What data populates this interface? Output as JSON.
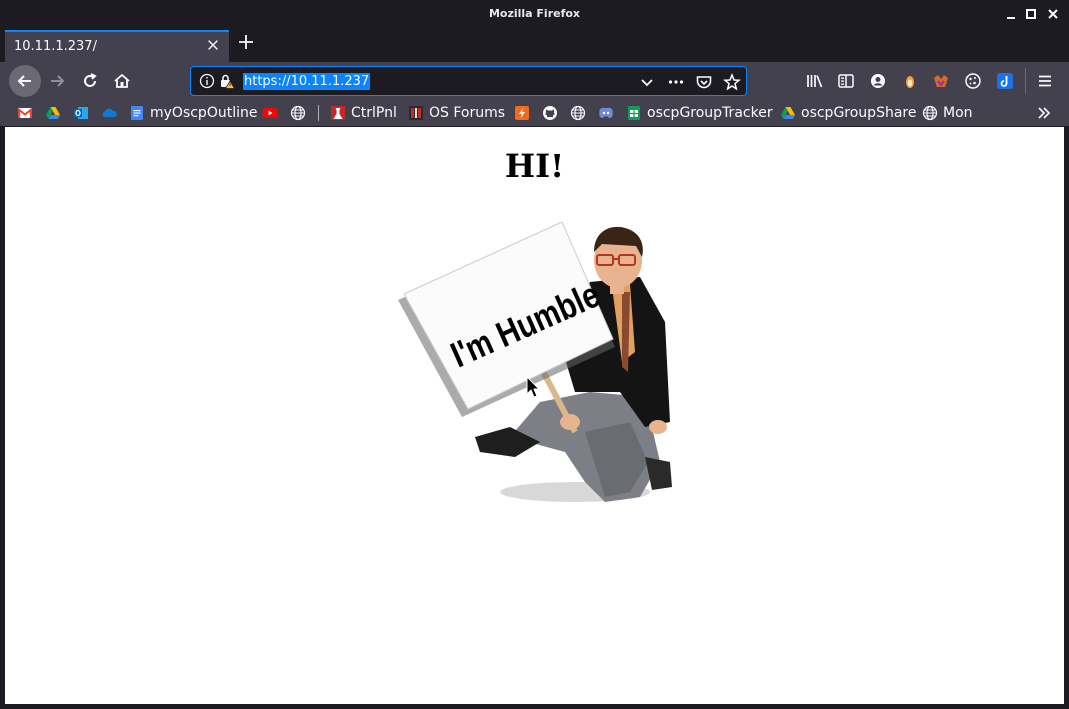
{
  "window": {
    "title": "Mozilla Firefox",
    "controls": [
      "minimize",
      "maximize",
      "close"
    ]
  },
  "tabs": [
    {
      "title": "10.11.1.237/",
      "active": true
    }
  ],
  "urlbar": {
    "url": "https://10.11.1.237"
  },
  "bookmarks": {
    "items": [
      {
        "label": "",
        "icon": "gmail-icon"
      },
      {
        "label": "",
        "icon": "google-drive-icon"
      },
      {
        "label": "",
        "icon": "outlook-icon"
      },
      {
        "label": "",
        "icon": "onedrive-icon"
      },
      {
        "label": "myOscpOutline",
        "icon": "google-docs-icon"
      },
      {
        "label": "",
        "icon": "youtube-icon"
      },
      {
        "label": "",
        "icon": "globe-icon"
      },
      {
        "label": "CtrlPnl",
        "icon": "ctrlpnl-icon"
      },
      {
        "label": "OS Forums",
        "icon": "os-forums-icon"
      },
      {
        "label": "",
        "icon": "bolt-icon"
      },
      {
        "label": "",
        "icon": "github-icon"
      },
      {
        "label": "",
        "icon": "globe-icon"
      },
      {
        "label": "",
        "icon": "discord-icon"
      },
      {
        "label": "oscpGroupTracker",
        "icon": "google-sheets-icon"
      },
      {
        "label": "oscpGroupShare",
        "icon": "google-drive-icon"
      },
      {
        "label": "Mon",
        "icon": "globe-icon"
      }
    ]
  },
  "page": {
    "heading": "HI!",
    "sign_text": "I'm Humble"
  },
  "colors": {
    "accent": "#0a84ff",
    "toolbar": "#42414d",
    "frame": "#1c1b22"
  }
}
